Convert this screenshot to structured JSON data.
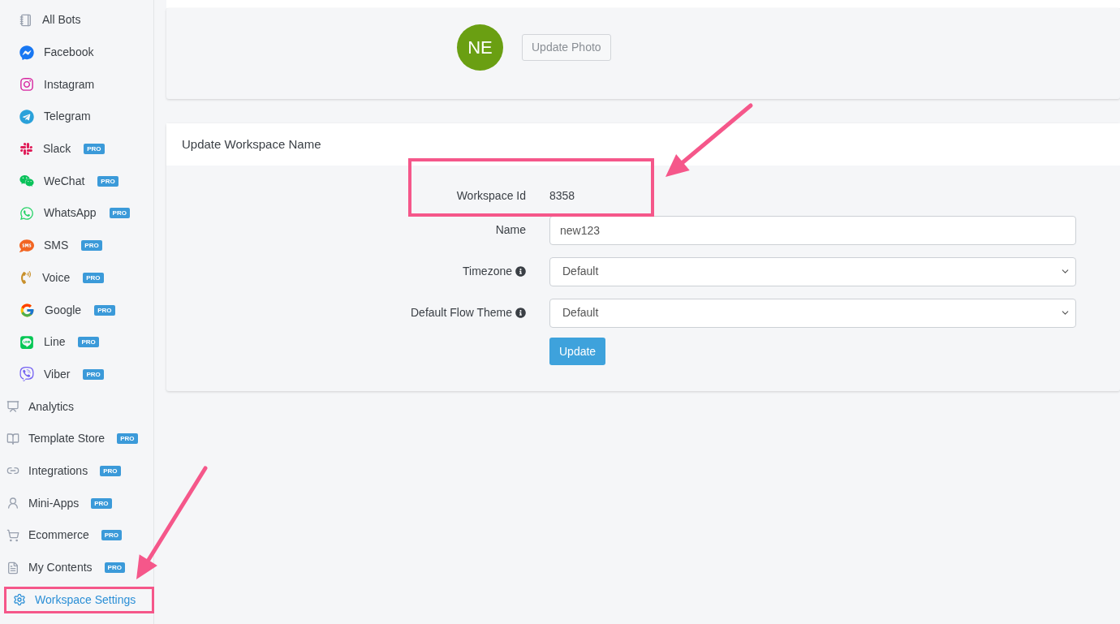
{
  "sidebar": {
    "items": [
      {
        "kind": "channel",
        "label": "All Bots",
        "pro": false,
        "selected": false,
        "highlighted": false
      },
      {
        "kind": "channel",
        "label": "Facebook",
        "pro": false,
        "selected": false,
        "highlighted": false
      },
      {
        "kind": "channel",
        "label": "Instagram",
        "pro": false,
        "selected": false,
        "highlighted": false
      },
      {
        "kind": "channel",
        "label": "Telegram",
        "pro": false,
        "selected": false,
        "highlighted": false
      },
      {
        "kind": "channel",
        "label": "Slack",
        "pro": true,
        "badge": "PRO",
        "selected": false,
        "highlighted": false
      },
      {
        "kind": "channel",
        "label": "WeChat",
        "pro": true,
        "badge": "PRO",
        "selected": false,
        "highlighted": false
      },
      {
        "kind": "channel",
        "label": "WhatsApp",
        "pro": true,
        "badge": "PRO",
        "selected": false,
        "highlighted": false
      },
      {
        "kind": "channel",
        "label": "SMS",
        "pro": true,
        "badge": "PRO",
        "selected": false,
        "highlighted": false
      },
      {
        "kind": "channel",
        "label": "Voice",
        "pro": true,
        "badge": "PRO",
        "selected": false,
        "highlighted": false
      },
      {
        "kind": "channel",
        "label": "Google",
        "pro": true,
        "badge": "PRO",
        "selected": false,
        "highlighted": false
      },
      {
        "kind": "channel",
        "label": "Line",
        "pro": true,
        "badge": "PRO",
        "selected": false,
        "highlighted": false
      },
      {
        "kind": "channel",
        "label": "Viber",
        "pro": true,
        "badge": "PRO",
        "selected": false,
        "highlighted": false
      },
      {
        "kind": "nav",
        "label": "Analytics",
        "pro": false,
        "selected": false,
        "highlighted": false
      },
      {
        "kind": "nav",
        "label": "Template Store",
        "pro": true,
        "badge": "PRO",
        "selected": false,
        "highlighted": false
      },
      {
        "kind": "nav",
        "label": "Integrations",
        "pro": true,
        "badge": "PRO",
        "selected": false,
        "highlighted": false
      },
      {
        "kind": "nav",
        "label": "Mini-Apps",
        "pro": true,
        "badge": "PRO",
        "selected": false,
        "highlighted": false
      },
      {
        "kind": "nav",
        "label": "Ecommerce",
        "pro": true,
        "badge": "PRO",
        "selected": false,
        "highlighted": false
      },
      {
        "kind": "nav",
        "label": "My Contents",
        "pro": true,
        "badge": "PRO",
        "selected": false,
        "highlighted": false
      },
      {
        "kind": "nav",
        "label": "Workspace Settings",
        "pro": false,
        "selected": true,
        "highlighted": true
      }
    ]
  },
  "photo_card": {
    "avatar": {
      "initials": "NE",
      "color": "#6a9f12"
    },
    "button": "Update Photo"
  },
  "workspace_card": {
    "title": "Update Workspace Name",
    "workspace_id": {
      "label": "Workspace Id",
      "value": "8358",
      "highlighted": true
    },
    "fields": [
      {
        "kind": "input",
        "label": "Name",
        "info": false,
        "value": "new123"
      },
      {
        "kind": "select",
        "label": "Timezone",
        "info": true,
        "value": "Default"
      },
      {
        "kind": "select",
        "label": "Default Flow Theme",
        "info": true,
        "value": "Default"
      }
    ],
    "submit": "Update"
  }
}
